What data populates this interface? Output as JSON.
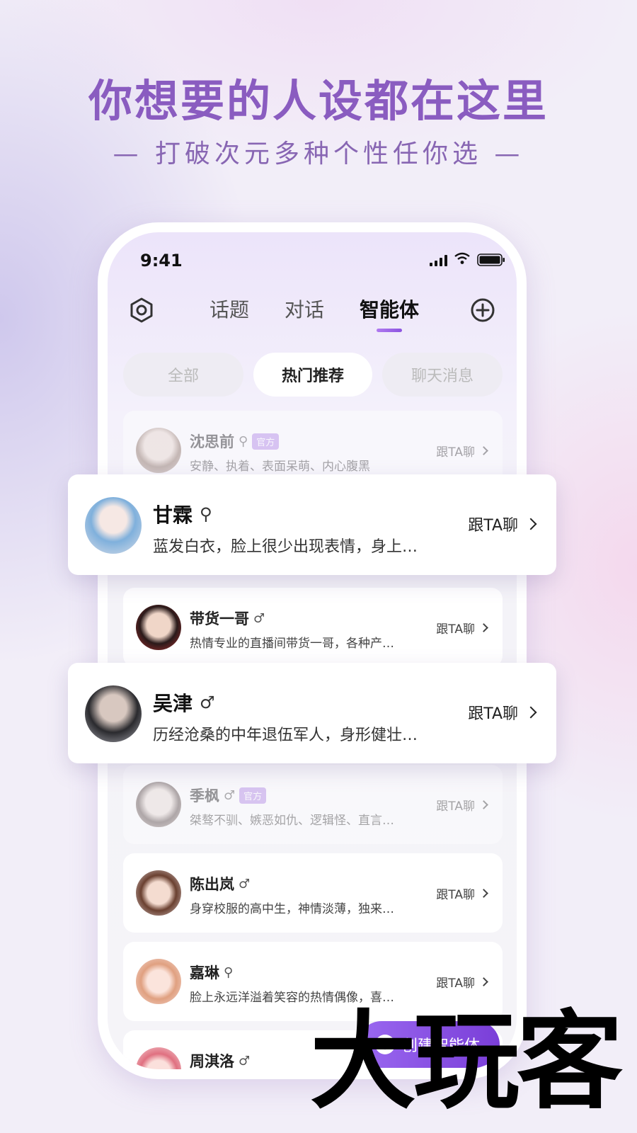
{
  "promo": {
    "headline": "你想要的人设都在这里",
    "subline": "— 打破次元多种个性任你选 —"
  },
  "status_bar": {
    "time": "9:41"
  },
  "nav": {
    "tabs": [
      {
        "label": "话题"
      },
      {
        "label": "对话"
      },
      {
        "label": "智能体",
        "active": true
      }
    ],
    "left_icon": "settings-hexagon-icon",
    "right_icon": "add-circle-icon"
  },
  "filters": [
    {
      "label": "全部"
    },
    {
      "label": "热门推荐",
      "active": true
    },
    {
      "label": "聊天消息"
    }
  ],
  "action_label": "跟TA聊",
  "official_badge": "官方",
  "characters": [
    {
      "name": "沈思前",
      "gender": "female",
      "official": true,
      "description": "安静、执着、表面呆萌、内心腹黑"
    },
    {
      "name": "甘霖",
      "gender": "female",
      "description": "蓝发白衣，脸上很少出现表情，身上…"
    },
    {
      "name": "带货一哥",
      "gender": "male",
      "description": "热情专业的直播间带货一哥，各种产…"
    },
    {
      "name": "吴津",
      "gender": "male",
      "description": "历经沧桑的中年退伍军人，身形健壮…"
    },
    {
      "name": "季枫",
      "gender": "male",
      "official": true,
      "description": "桀骜不驯、嫉恶如仇、逻辑怪、直言…"
    },
    {
      "name": "陈出岚",
      "gender": "male",
      "description": "身穿校服的高中生，神情淡薄，独来…"
    },
    {
      "name": "嘉琳",
      "gender": "female",
      "description": "脸上永远洋溢着笑容的热情偶像，喜…"
    },
    {
      "name": "周淇洛",
      "gender": "male",
      "description": ""
    }
  ],
  "create_button": {
    "label": "创建智能体"
  },
  "watermark": "大玩客",
  "colors": {
    "accent": "#8c54e0",
    "headline": "#8a5cc0",
    "badge": "#b48ce8"
  }
}
